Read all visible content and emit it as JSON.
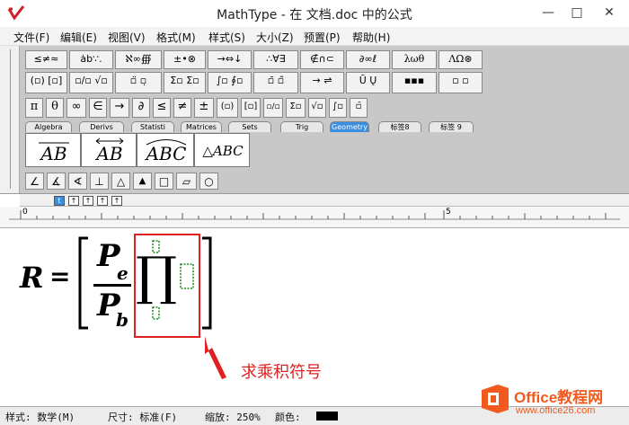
{
  "window": {
    "title": "MathType - 在 文档.doc 中的公式",
    "min": "—",
    "max": "□",
    "close": "✕"
  },
  "menu": [
    "文件(F)",
    "编辑(E)",
    "视图(V)",
    "格式(M)",
    "样式(S)",
    "大小(Z)",
    "预置(P)",
    "帮助(H)"
  ],
  "palette_row1": [
    "≤≠≈",
    "ȧb∵.",
    "ℵ∞∰",
    "±•⊗",
    "→⇔↓",
    "∴∀∃",
    "∉∩⊂",
    "∂∞ℓ",
    "λωθ",
    "ΛΩ⊛"
  ],
  "palette_row2": [
    "(▫) [▫]",
    "▫/▫ √▫",
    "▫̈ ▫̣",
    "Σ▫ Σ▫",
    "∫▫ ∮▫",
    "▫̄ ▫̃",
    "→ ⇌",
    "Ū Ų",
    "▪▪▪",
    "▫ ▫"
  ],
  "symbol_row": [
    "π",
    "θ",
    "∞",
    "∈",
    "→",
    "∂",
    "≤",
    "≠",
    "±",
    "(▫)",
    "[▫]",
    "▫/▫",
    "Σ▫",
    "√▫",
    "∫▫",
    "▫̄"
  ],
  "tabs": [
    "Algebra",
    "Derivs",
    "Statisti",
    "Matrices",
    "Sets",
    "Trig",
    "Geometry",
    "标签8",
    "标签 9"
  ],
  "selected_tab": "Geometry",
  "templates": [
    "AB",
    "AB",
    "ABC",
    "△ABC"
  ],
  "geo_symbols": [
    "∠",
    "∡",
    "∢",
    "⊥",
    "△",
    "▲",
    "□",
    "▱",
    "○"
  ],
  "small_buttons": [
    "t",
    "↑",
    "↑",
    "↑",
    "↑"
  ],
  "ruler": {
    "start": "0",
    "mid": "5"
  },
  "equation": {
    "lhs": "R",
    "eq": "=",
    "num_main": "P",
    "num_sub": "e",
    "den_main": "P",
    "den_sub": "b",
    "product": "∏"
  },
  "annotation": "求乘积符号",
  "status": {
    "style": "样式: 数学(M)",
    "size": "尺寸: 标准(F)",
    "zoom": "缩放: 250%",
    "color": "颜色:"
  },
  "watermark": {
    "brand": "Office教程网",
    "url": "www.office26.com"
  },
  "colors": {
    "tab_selected": "#3a8ee0",
    "annotation": "#e02020",
    "slot": "#1b8a1b",
    "watermark_orange": "#f05a1e"
  }
}
